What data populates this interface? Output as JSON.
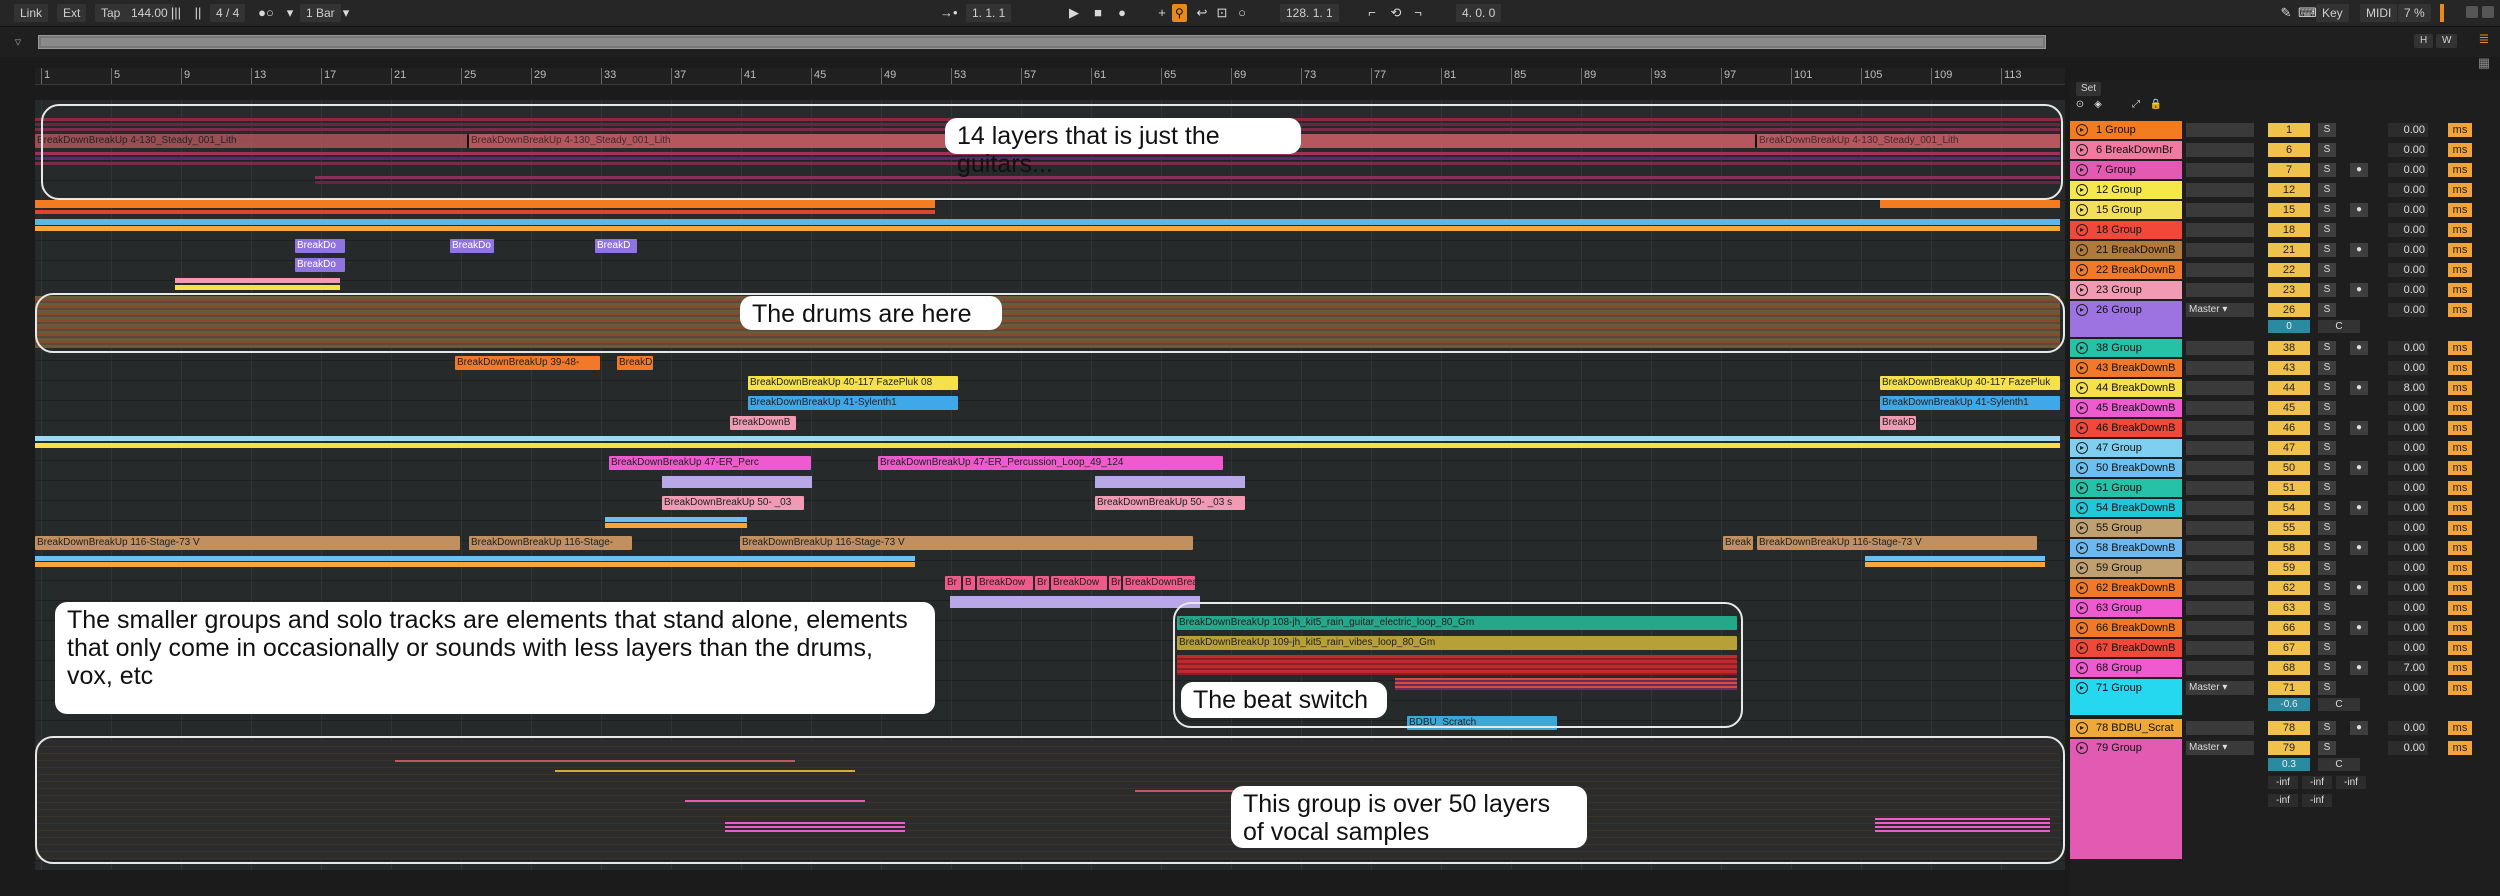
{
  "transport": {
    "link": "Link",
    "ext": "Ext",
    "tap": "Tap",
    "tempo": "144.00",
    "signature": "4 / 4",
    "quantize": "1 Bar",
    "position": "1.  1.  1",
    "loop_start": "128.  1.  1",
    "loop_length": "4.  0.  0",
    "key": "Key",
    "midi": "MIDI",
    "cpu": "7 %"
  },
  "overview": {
    "h_label": "H",
    "w_label": "W"
  },
  "ruler": {
    "bars": [
      "1",
      "5",
      "9",
      "13",
      "17",
      "21",
      "25",
      "29",
      "33",
      "37",
      "41",
      "45",
      "49",
      "53",
      "57",
      "61",
      "65",
      "69",
      "73",
      "77",
      "81",
      "85",
      "89",
      "93",
      "97",
      "101",
      "105",
      "109",
      "113"
    ]
  },
  "clips": {
    "steady_1": "BreakDownBreakUp 4-130_Steady_001_Lith",
    "steady_2": "BreakDownBreakUp 4-130_Steady_001_Lith",
    "steady_3": "BreakDownBreakUp 4-130_Steady_001_Lith",
    "bd_a": "BreakDo",
    "bd_b": "BreakDo",
    "bd_c": "BreakD",
    "bd_d": "BreakDo",
    "t43_a": "BreakDownBreakUp 39-48-",
    "t43_b": "BreakD",
    "t44_a": "BreakDownBreakUp 40-117 FazePluk 08",
    "t44_b": "BreakDownBreakUp 40-117 FazePluk",
    "t45_a": "BreakDownBreakUp 41-Sylenth1",
    "t45_b": "BreakDownBreakUp 41-Sylenth1",
    "t46_a": "BreakDownB",
    "t46_b": "BreakD",
    "t50_a": "BreakDownBreakUp 47-ER_Perc",
    "t50_b": "BreakDownBreakUp 47-ER_Percussion_Loop_49_124",
    "t54_a": "BreakDownBreakUp 50- _03",
    "t54_b": "BreakDownBreakUp 50- _03 s",
    "t58_a": "BreakDownBreakUp 116-Stage-73 V",
    "t58_b": "BreakDownBreakUp 116-Stage-",
    "t58_c": "BreakDownBreakUp 116-Stage-73 V",
    "t58_d": "Break",
    "t58_e": "BreakDownBreakUp 116-Stage-73 V",
    "t62_a": "Br",
    "t62_b": "B",
    "t62_c": "BreakDow",
    "t62_d": "Br",
    "t62_e": "BreakDow",
    "t62_f": "Br",
    "t62_g": "BreakDownBrea",
    "t71_a": "BreakDownBreakUp 108-jh_kit5_rain_guitar_electric_loop_80_Gm",
    "t71_b": "BreakDownBreakUp 109-jh_kit5_rain_vibes_loop_80_Gm",
    "t78_a": "BDBU_Scratch"
  },
  "annotations": {
    "guitars": "14 layers that is just the guitars...",
    "drums": "The drums are here",
    "smaller_groups": "The smaller groups and solo tracks are elements that stand alone, elements that only come in occasionally or sounds with less layers than the drums, vox, etc",
    "beat_switch": "The beat switch",
    "vocals": "This group is over 50 layers of vocal samples"
  },
  "mixer": {
    "set_label": "Set",
    "master": "Master",
    "center": "C",
    "inf": "-inf",
    "tracks": [
      {
        "name": "1 Group",
        "num": "1",
        "vol": "0.00",
        "color": "#f47c20"
      },
      {
        "name": "6 BreakDownBr",
        "num": "6",
        "vol": "0.00",
        "color": "#f07aa0"
      },
      {
        "name": "7 Group",
        "num": "7",
        "vol": "0.00",
        "color": "#e35ab2"
      },
      {
        "name": "12 Group",
        "num": "12",
        "vol": "0.00",
        "color": "#f4e84a"
      },
      {
        "name": "15 Group",
        "num": "15",
        "vol": "0.00",
        "color": "#f2e05a"
      },
      {
        "name": "18 Group",
        "num": "18",
        "vol": "0.00",
        "color": "#f0493a"
      },
      {
        "name": "21 BreakDownB",
        "num": "21",
        "vol": "0.00",
        "color": "#b07a3c"
      },
      {
        "name": "22 BreakDownB",
        "num": "22",
        "vol": "0.00",
        "color": "#f3792a"
      },
      {
        "name": "23 Group",
        "num": "23",
        "vol": "0.00",
        "color": "#f09ab4"
      },
      {
        "name": "26 Group",
        "num": "26",
        "vol": "0.00",
        "color": "#9c73e0",
        "routing": "Master",
        "pan": "0"
      },
      {
        "name": "38 Group",
        "num": "38",
        "vol": "0.00",
        "color": "#25c2a8"
      },
      {
        "name": "43 BreakDownB",
        "num": "43",
        "vol": "0.00",
        "color": "#f3792a"
      },
      {
        "name": "44 BreakDownB",
        "num": "44",
        "vol": "8.00",
        "color": "#f5e24a"
      },
      {
        "name": "45 BreakDownB",
        "num": "45",
        "vol": "0.00",
        "color": "#f05ad0"
      },
      {
        "name": "46 BreakDownB",
        "num": "46",
        "vol": "0.00",
        "color": "#f0493a"
      },
      {
        "name": "47 Group",
        "num": "47",
        "vol": "0.00",
        "color": "#7fd0f0"
      },
      {
        "name": "50 BreakDownB",
        "num": "50",
        "vol": "0.00",
        "color": "#6cc0f0"
      },
      {
        "name": "51 Group",
        "num": "51",
        "vol": "0.00",
        "color": "#25c2a8"
      },
      {
        "name": "54 BreakDownB",
        "num": "54",
        "vol": "0.00",
        "color": "#22c8d8"
      },
      {
        "name": "55 Group",
        "num": "55",
        "vol": "0.00",
        "color": "#c0a070"
      },
      {
        "name": "58 BreakDownB",
        "num": "58",
        "vol": "0.00",
        "color": "#6cb8f0"
      },
      {
        "name": "59 Group",
        "num": "59",
        "vol": "0.00",
        "color": "#c0a070"
      },
      {
        "name": "62 BreakDownB",
        "num": "62",
        "vol": "0.00",
        "color": "#f3792a"
      },
      {
        "name": "63 Group",
        "num": "63",
        "vol": "0.00",
        "color": "#f05ad0"
      },
      {
        "name": "66 BreakDownB",
        "num": "66",
        "vol": "0.00",
        "color": "#f3792a"
      },
      {
        "name": "67 BreakDownB",
        "num": "67",
        "vol": "0.00",
        "color": "#f0493a"
      },
      {
        "name": "68 Group",
        "num": "68",
        "vol": "7.00",
        "color": "#f05ad0"
      },
      {
        "name": "71 Group",
        "num": "71",
        "vol": "0.00",
        "color": "#25d8f0",
        "routing": "Master",
        "pan": "-0.6"
      },
      {
        "name": "78 BDBU_Scrat",
        "num": "78",
        "vol": "0.00",
        "color": "#f0a838"
      },
      {
        "name": "79 Group",
        "num": "79",
        "vol": "0.00",
        "color": "#e35ab2",
        "routing": "Master",
        "pan": "0.3"
      }
    ]
  }
}
